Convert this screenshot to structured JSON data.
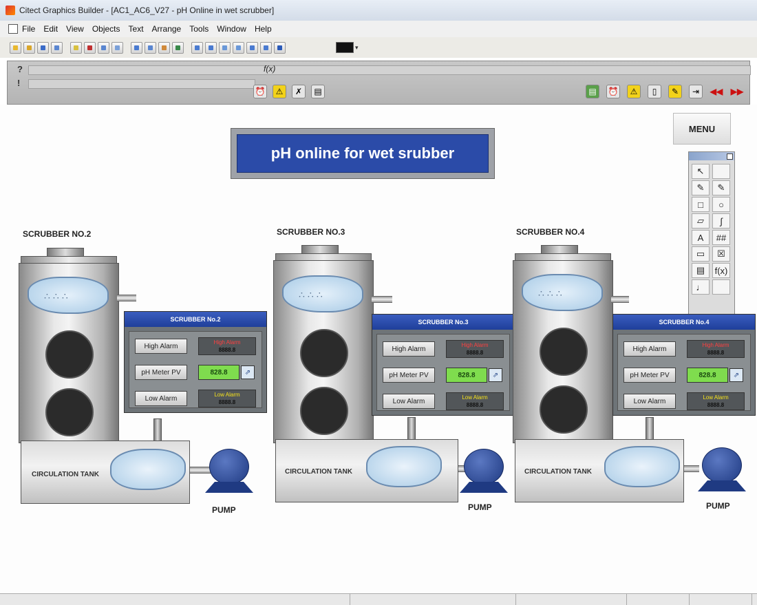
{
  "window": {
    "title": "Citect Graphics Builder - [AC1_AC6_V27 - pH Online in wet scrubber]"
  },
  "menu": [
    "File",
    "Edit",
    "View",
    "Objects",
    "Text",
    "Arrange",
    "Tools",
    "Window",
    "Help"
  ],
  "page": {
    "title": "pH online for wet srubber",
    "menu_label": "MENU"
  },
  "panel": {
    "q_label": "?",
    "info_label": "!",
    "fx_label": "f(x)"
  },
  "scrubbers": [
    {
      "label": "SCRUBBER NO.2",
      "panel_title": "SCRUBBER No.2",
      "high_btn": "High Alarm",
      "pv_btn": "pH Meter PV",
      "low_btn": "Low Alarm",
      "high_text": "High Alarm",
      "high_val": "8888.8",
      "pv_val": "828.8",
      "low_text": "Low Alarm",
      "low_val": "8888.8",
      "tank_label": "CIRCULATION TANK",
      "pump_label": "PUMP"
    },
    {
      "label": "SCRUBBER NO.3",
      "panel_title": "SCRUBBER No.3",
      "high_btn": "High Alarm",
      "pv_btn": "pH Meter PV",
      "low_btn": "Low Alarm",
      "high_text": "High Alarm",
      "high_val": "8888.8",
      "pv_val": "828.8",
      "low_text": "Low Alarm",
      "low_val": "8888.8",
      "tank_label": "CIRCULATION TANK",
      "pump_label": "PUMP"
    },
    {
      "label": "SCRUBBER NO.4",
      "panel_title": "SCRUBBER No.4",
      "high_btn": "High Alarm",
      "pv_btn": "pH Meter PV",
      "low_btn": "Low Alarm",
      "high_text": "High Alarm",
      "high_val": "8888.8",
      "pv_val": "828.8",
      "low_text": "Low Alarm",
      "low_val": "8888.8",
      "tank_label": "CIRCULATION TANK",
      "pump_label": "PUMP"
    }
  ],
  "toolbox": {
    "tools": [
      "↖",
      "",
      "✎",
      "✎",
      "□",
      "○",
      "▱",
      "∫",
      "A",
      "##",
      "▭",
      "☒",
      "▤",
      "f(x)",
      "♩",
      ""
    ]
  },
  "colors": {
    "accent": "#2b4ba8",
    "pv_green": "#7fdc4e",
    "pump_blue": "#1f3a82",
    "alarm_red": "#ff4040",
    "alarm_yellow": "#f4e11c"
  }
}
